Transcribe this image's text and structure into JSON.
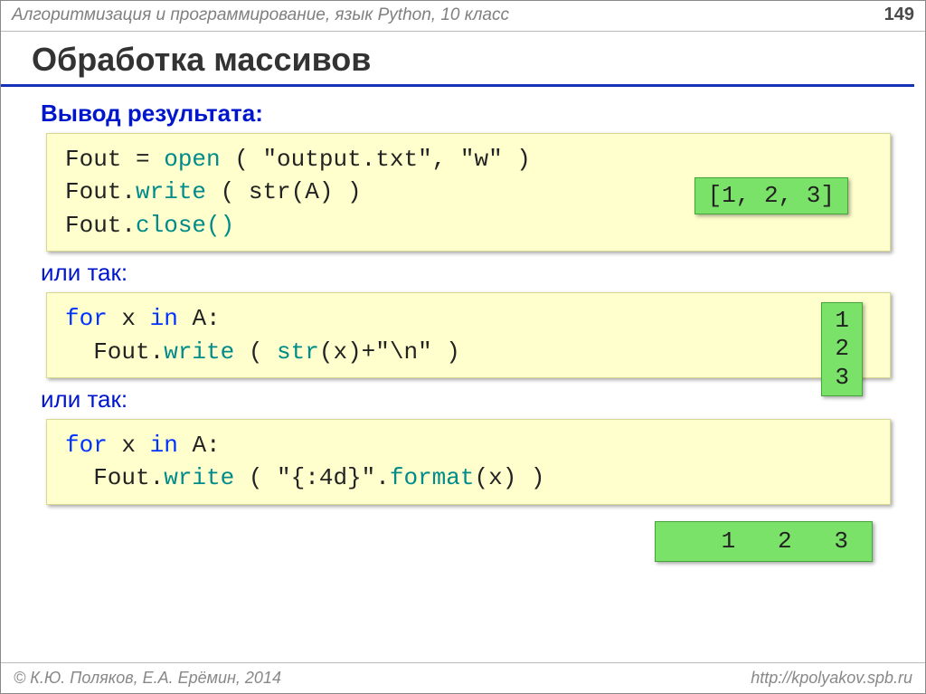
{
  "header": {
    "course": "Алгоритмизация и программирование, язык Python, 10 класс",
    "page": "149"
  },
  "title": "Обработка массивов",
  "sec1": {
    "heading": "Вывод результата:",
    "code": {
      "a1": "Fout = ",
      "open": "open",
      "a2": " ( \"output.txt\", \"w\" )",
      "b1": "Fout.",
      "write": "write",
      "b2": " ( str(A) )",
      "c1": "Fout.",
      "close": "close()"
    },
    "output": "[1, 2, 3]"
  },
  "sec2": {
    "heading": "или так:",
    "code": {
      "a1": "for",
      "a2": " x ",
      "in": "in",
      "a3": " A:",
      "b1": "  Fout.",
      "write": "write",
      "b2": " ( ",
      "str": "str",
      "b3": "(x)+",
      "nl": "\"\\n\"",
      "b4": " )"
    },
    "output": "1\n2\n3"
  },
  "sec3": {
    "heading": "или так:",
    "code": {
      "a1": "for",
      "a2": " x ",
      "in": "in",
      "a3": " A:",
      "b1": "  Fout.",
      "write": "write",
      "b2": " ( \"{:4d}\".",
      "format": "format",
      "b3": "(x) )"
    },
    "output": "   1   2   3"
  },
  "footer": {
    "copyright": "© К.Ю. Поляков, Е.А. Ерёмин, 2014",
    "url": "http://kpolyakov.spb.ru"
  }
}
